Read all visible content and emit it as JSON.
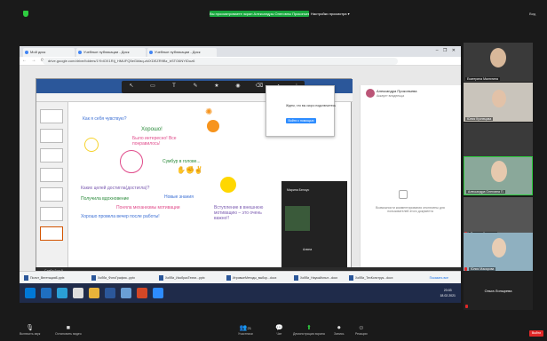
{
  "top": {
    "share_banner": "Вы просматриваете экран Александры Олеговны Прокопьевой",
    "settings": "Настройки просмотра ▾",
    "view": "Вид"
  },
  "browser": {
    "tabs": [
      "Мой диск",
      "Учебные публикации - Диск",
      "Учебные публикации - Диск"
    ],
    "url": "drive.google.com/drive/folders/1YbIOX1RIj_HMUFQ5eGkfaq-zkIXDEZR9Bz_bSTO6NYIDuz6",
    "window_controls": "– ❐ ✕"
  },
  "slide": {
    "q1": "Как я себя чувствую?",
    "a1": "Хорошо!",
    "a2": "Было интересно! Все понравилось!",
    "a3": "Сумбур в голове...",
    "q2": "Каких целей достигла(достигла)?",
    "a4": "Получила вдохновение",
    "a5": "Новые знания",
    "a6": "Поняла механизмы мотивации",
    "a7": "Хорошо провела вечер после работы!",
    "a8": "Вступление в внешнюю мотивацию – это очень важно!!"
  },
  "panel": {
    "name": "Александра Прокопьева",
    "sub": "Аккаунт владельца",
    "msg": "Возможности комментирования отключены для пользователей этого документа"
  },
  "popup": {
    "text": "Ждем, что вы скоро подключитесь",
    "button": "Войти с помощью звука"
  },
  "video": {
    "name1": "Марина Белоус",
    "name2": "Алина"
  },
  "status_bar": "Слайд 9 из 9",
  "downloads": [
    "Пилот_ВегетацияБ.pptx",
    "Хобби_ФотоГрафия...pptx",
    "Хобби_ИзобразТехни...pptx",
    "ИгровыеМетоды_выбор...docx",
    "Хобби_НаукаИспыт...docx",
    "Хобби_ТехКонструк...docx"
  ],
  "downloads_showall": "Показать все",
  "tray": {
    "time": "23:03",
    "date": "18.02.2021"
  },
  "gallery": [
    "Екатерина Малютина",
    "Юлия Кузнецова",
    "Андрей",
    "Александра Олеговна П.",
    "Татьяна Крылова",
    "Юлия Макарова"
  ],
  "gallery_text_tile": "Ольга Лопырева",
  "bottom": {
    "mute": "Включить звук",
    "video": "Остановить видео",
    "participants": "Участники",
    "participants_count": "21",
    "chat": "Чат",
    "share": "Демонстрация экрана",
    "record": "Запись",
    "reactions": "Реакции",
    "leave": "Выйти"
  },
  "colors": {
    "zoom_green": "#2ecc40",
    "leave_red": "#e02828",
    "ppt_blue": "#2b579a"
  }
}
